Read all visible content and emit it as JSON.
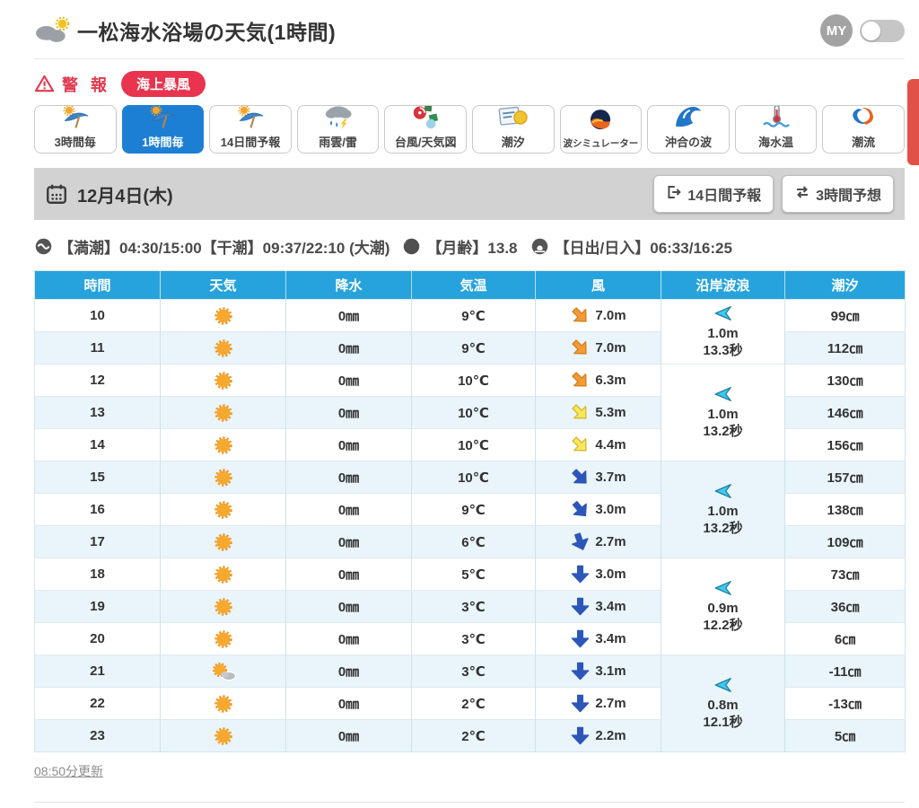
{
  "header": {
    "title": "一松海水浴場の天気(1時間)",
    "my_label": "MY"
  },
  "alert": {
    "warning_label": "警報",
    "badge_label": "海上暴風"
  },
  "tabs": [
    {
      "id": "tab-3hourly",
      "icon": "sun-umbrella-icon",
      "label": "3時間毎",
      "selected": false
    },
    {
      "id": "tab-1hourly",
      "icon": "sun-umbrella-icon",
      "label": "1時間毎",
      "selected": true
    },
    {
      "id": "tab-14day",
      "icon": "sun-umbrella-icon",
      "label": "14日間予報",
      "selected": false
    },
    {
      "id": "tab-rain-radar",
      "icon": "rain-cloud-icon",
      "label": "雨雲/雷",
      "selected": false
    },
    {
      "id": "tab-typhoon-map",
      "icon": "typhoon-map-icon",
      "label": "台風/天気図",
      "selected": false
    },
    {
      "id": "tab-tide",
      "icon": "tide-calendar-icon",
      "label": "潮汐",
      "selected": false
    },
    {
      "id": "tab-wave-sim",
      "icon": "wave-simulator-icon",
      "label": "波シミュレーター",
      "selected": false
    },
    {
      "id": "tab-offshore-wave",
      "icon": "offshore-wave-icon",
      "label": "沖合の波",
      "selected": false
    },
    {
      "id": "tab-sea-temp",
      "icon": "sea-temp-icon",
      "label": "海水温",
      "selected": false
    },
    {
      "id": "tab-current",
      "icon": "current-icon",
      "label": "潮流",
      "selected": false
    }
  ],
  "date_bar": {
    "date": "12月4日(木)",
    "buttons": [
      {
        "id": "fourteen-day-button",
        "icon": "external-icon",
        "label": "14日間予報"
      },
      {
        "id": "three-hour-button",
        "icon": "swap-icon",
        "label": "3時間予想"
      }
    ]
  },
  "tide_info": {
    "segments": [
      {
        "icon": "wave-circle-icon",
        "text": "【満潮】04:30/15:00【干潮】09:37/22:10 (大潮)"
      },
      {
        "icon": "moon-icon",
        "text": "【月齢】13.8"
      },
      {
        "icon": "sunrise-icon",
        "text": "【日出/日入】06:33/16:25"
      }
    ]
  },
  "table": {
    "headers": [
      "時間",
      "天気",
      "降水",
      "気温",
      "風",
      "沿岸波浪",
      "潮汐"
    ],
    "rows": [
      {
        "time": "10",
        "weather": "sun",
        "precip": "0㎜",
        "temp": "9℃",
        "wind_speed": "7.0m",
        "wind_color": "orange",
        "wind_dir": -45,
        "tide": "99㎝"
      },
      {
        "time": "11",
        "weather": "sun",
        "precip": "0㎜",
        "temp": "9℃",
        "wind_speed": "7.0m",
        "wind_color": "orange",
        "wind_dir": -45,
        "tide": "112㎝"
      },
      {
        "time": "12",
        "weather": "sun",
        "precip": "0㎜",
        "temp": "10℃",
        "wind_speed": "6.3m",
        "wind_color": "orange",
        "wind_dir": -45,
        "tide": "130㎝"
      },
      {
        "time": "13",
        "weather": "sun",
        "precip": "0㎜",
        "temp": "10℃",
        "wind_speed": "5.3m",
        "wind_color": "yellow",
        "wind_dir": -45,
        "tide": "146㎝"
      },
      {
        "time": "14",
        "weather": "sun",
        "precip": "0㎜",
        "temp": "10℃",
        "wind_speed": "4.4m",
        "wind_color": "yellow",
        "wind_dir": -45,
        "tide": "156㎝"
      },
      {
        "time": "15",
        "weather": "sun",
        "precip": "0㎜",
        "temp": "10℃",
        "wind_speed": "3.7m",
        "wind_color": "blue",
        "wind_dir": -45,
        "tide": "157㎝"
      },
      {
        "time": "16",
        "weather": "sun",
        "precip": "0㎜",
        "temp": "9℃",
        "wind_speed": "3.0m",
        "wind_color": "blue",
        "wind_dir": -40,
        "tide": "138㎝"
      },
      {
        "time": "17",
        "weather": "sun",
        "precip": "0㎜",
        "temp": "6℃",
        "wind_speed": "2.7m",
        "wind_color": "blue",
        "wind_dir": -20,
        "tide": "109㎝"
      },
      {
        "time": "18",
        "weather": "sun",
        "precip": "0㎜",
        "temp": "5℃",
        "wind_speed": "3.0m",
        "wind_color": "blue",
        "wind_dir": 0,
        "tide": "73㎝"
      },
      {
        "time": "19",
        "weather": "sun",
        "precip": "0㎜",
        "temp": "3℃",
        "wind_speed": "3.4m",
        "wind_color": "blue",
        "wind_dir": 0,
        "tide": "36㎝"
      },
      {
        "time": "20",
        "weather": "sun",
        "precip": "0㎜",
        "temp": "3℃",
        "wind_speed": "3.4m",
        "wind_color": "blue",
        "wind_dir": 0,
        "tide": "6㎝"
      },
      {
        "time": "21",
        "weather": "sun-cloud",
        "precip": "0㎜",
        "temp": "3℃",
        "wind_speed": "3.1m",
        "wind_color": "blue",
        "wind_dir": 0,
        "tide": "-11㎝"
      },
      {
        "time": "22",
        "weather": "sun",
        "precip": "0㎜",
        "temp": "2℃",
        "wind_speed": "2.7m",
        "wind_color": "blue",
        "wind_dir": 0,
        "tide": "-13㎝"
      },
      {
        "time": "23",
        "weather": "sun",
        "precip": "0㎜",
        "temp": "2℃",
        "wind_speed": "2.2m",
        "wind_color": "blue",
        "wind_dir": 0,
        "tide": "5㎝"
      }
    ],
    "wave_groups": [
      {
        "span": 2,
        "height": "1.0m",
        "period": "13.3秒",
        "shaded": false
      },
      {
        "span": 3,
        "height": "1.0m",
        "period": "13.2秒",
        "shaded": false
      },
      {
        "span": 3,
        "height": "1.0m",
        "period": "13.2秒",
        "shaded": true
      },
      {
        "span": 3,
        "height": "0.9m",
        "period": "12.2秒",
        "shaded": false
      },
      {
        "span": 3,
        "height": "0.8m",
        "period": "12.1秒",
        "shaded": true
      }
    ]
  },
  "footer": {
    "updated_label": "08:50分更新"
  },
  "colors": {
    "accent_blue": "#1d7fd4",
    "table_header_blue": "#26a3dc",
    "stripe_blue": "#e9f4fb",
    "alert_red": "#e8344e",
    "wind_orange": "#f29b38",
    "wind_yellow": "#f7e75c",
    "wind_blue": "#2d56b9",
    "wave_cyan": "#41c8f0"
  }
}
